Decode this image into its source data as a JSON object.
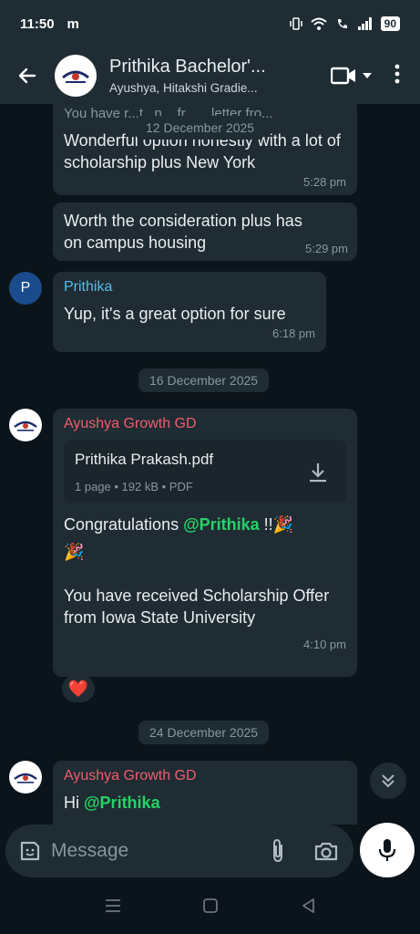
{
  "status_bar": {
    "time": "11:50",
    "carrier_letter": "m",
    "battery": "90"
  },
  "header": {
    "title": "Prithika Bachelor'...",
    "subtitle": "Ayushya, Hitakshi Gradie..."
  },
  "messages": [
    {
      "partial_quote": "You have r...t...n... fr... ...letter fro...",
      "text": "Wonderful option honestly with a lot of scholarship plus New York",
      "time": "5:28 pm"
    },
    {
      "text": "Worth the consideration plus has on campus housing",
      "time": "5:29 pm"
    },
    {
      "sender": "Prithika",
      "avatar_letter": "P",
      "text": "Yup, it's a great option for sure",
      "time": "6:18 pm"
    },
    {
      "sender": "Ayushya Growth GD",
      "doc": {
        "name": "Prithika Prakash.pdf",
        "meta": "1 page • 192 kB • PDF"
      },
      "text_prefix": "Congratulations ",
      "mention": "@Prithika",
      "text_suffix": " !!🎉",
      "text_emoji": "🎉",
      "text_body": "You have received Scholarship Offer from Iowa State University",
      "time": "4:10 pm",
      "reaction": "❤️"
    },
    {
      "sender": "Ayushya Growth GD",
      "text_prefix": "Hi ",
      "mention": "@Prithika"
    }
  ],
  "dates": [
    "12 December 2025",
    "16 December 2025",
    "24 December 2025"
  ],
  "composer": {
    "placeholder": "Message"
  },
  "colors": {
    "sender_ayushya": "#f15c6d",
    "sender_prithika": "#53bdeb",
    "mention": "#25d366"
  },
  "icons": [
    "back-arrow-icon",
    "video-call-icon",
    "dropdown-icon",
    "more-options-icon",
    "download-icon",
    "scroll-down-icon",
    "sticker-icon",
    "attach-icon",
    "camera-icon",
    "mic-icon"
  ]
}
